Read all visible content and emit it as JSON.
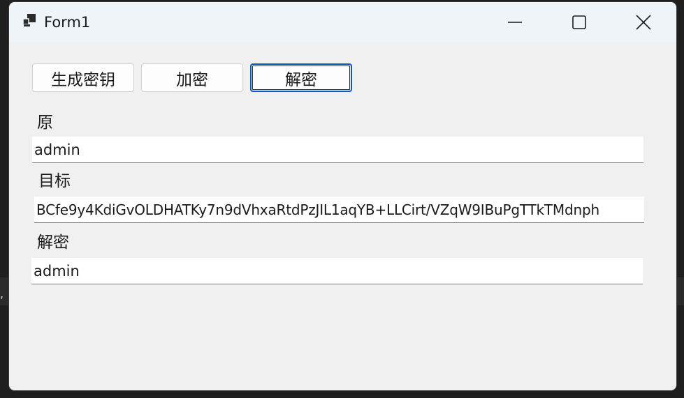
{
  "window": {
    "title": "Form1",
    "app_icon": "winforms-app-icon",
    "controls": {
      "minimize_icon": "minimize-icon",
      "maximize_icon": "maximize-icon",
      "close_icon": "close-icon"
    }
  },
  "buttons": {
    "generate_key": "生成密钥",
    "encrypt": "加密",
    "decrypt": "解密"
  },
  "fields": {
    "source": {
      "label": "原",
      "value": "admin"
    },
    "target": {
      "label": "目标",
      "value": "BCfe9y4KdiGvOLDHATKy7n9dVhxaRtdPzJIL1aqYB+LLCirt/VZqW9IBuPgTTkTMdnph"
    },
    "decrypted": {
      "label": "解密",
      "value": "admin"
    }
  },
  "colors": {
    "focus_border": "#0a59c1",
    "titlebar": "#eff4f9",
    "client": "#f0f0f0"
  }
}
